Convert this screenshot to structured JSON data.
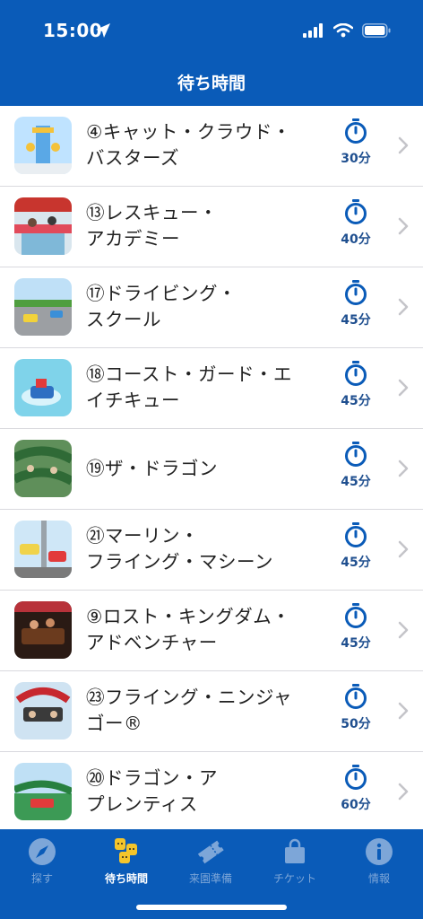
{
  "status": {
    "time": "15:00"
  },
  "header": {
    "title": "待ち時間"
  },
  "rides": [
    {
      "line1": "④キャット・クラウド・",
      "line2": "バスターズ",
      "wait": "30分"
    },
    {
      "line1": "⑬レスキュー・",
      "line2": "アカデミー",
      "wait": "40分"
    },
    {
      "line1": "⑰ドライビング・",
      "line2": "スクール",
      "wait": "45分"
    },
    {
      "line1": "⑱コースト・ガード・エ",
      "line2": "イチキュー",
      "wait": "45分"
    },
    {
      "line1": "⑲ザ・ドラゴン",
      "line2": "",
      "wait": "45分"
    },
    {
      "line1": "㉑マーリン・",
      "line2": "フライング・マシーン",
      "wait": "45分"
    },
    {
      "line1": "⑨ロスト・キングダム・",
      "line2": "アドベンチャー",
      "wait": "45分"
    },
    {
      "line1": "㉓フライング・ニンジャ",
      "line2": "ゴー®",
      "wait": "50分"
    },
    {
      "line1": "⑳ドラゴン・ア",
      "line2": "プレンティス",
      "wait": "60分"
    }
  ],
  "tabbar": {
    "explore": "探す",
    "wait_times": "待ち時間",
    "visit_prep": "来園準備",
    "tickets": "チケット",
    "info": "情報"
  },
  "colors": {
    "brand_blue": "#0a5bb8",
    "tab_inactive": "#7da6d8"
  }
}
